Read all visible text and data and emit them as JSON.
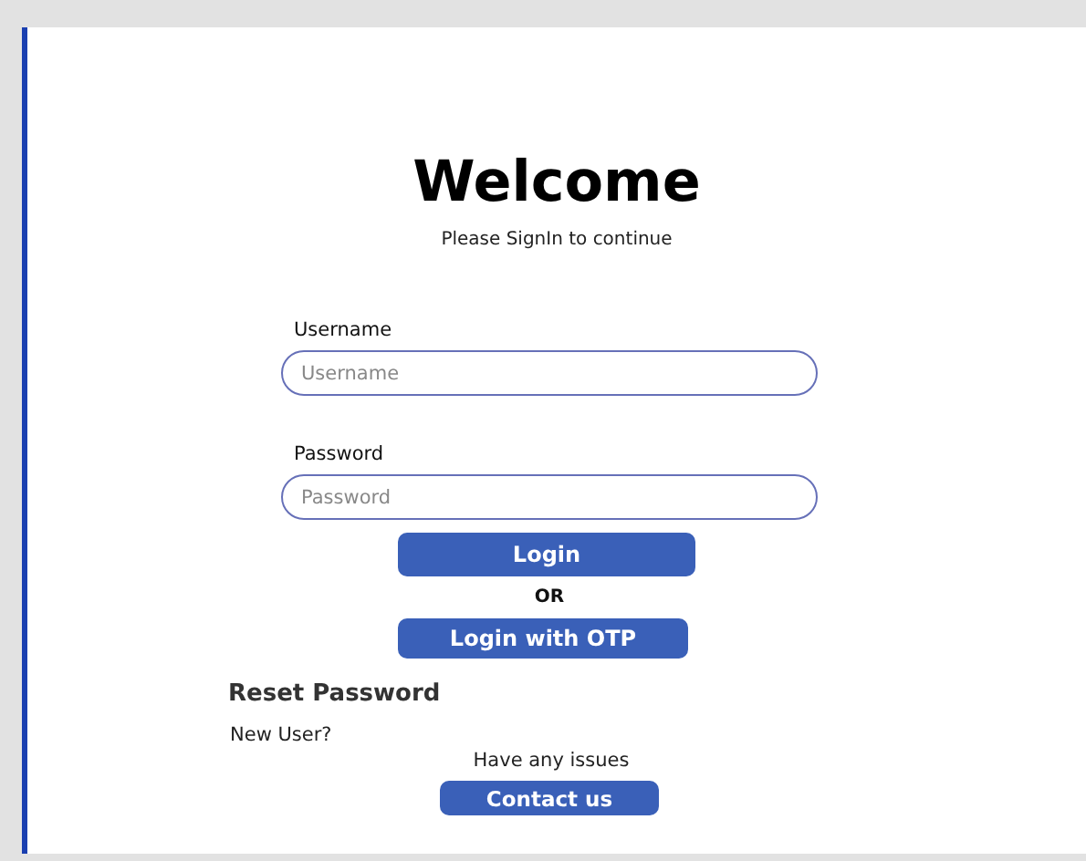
{
  "title": "Welcome",
  "subtitle": "Please SignIn to continue",
  "fields": [
    {
      "label": "Username",
      "placeholder": "Username"
    },
    {
      "label": "Password",
      "placeholder": "Password"
    }
  ],
  "login_button": "Login",
  "separator": "OR",
  "otp_button": "Login with OTP",
  "reset_link": "Reset Password",
  "new_user_link": "New User?",
  "issues_text": "Have any issues",
  "contact_button": "Contact us"
}
